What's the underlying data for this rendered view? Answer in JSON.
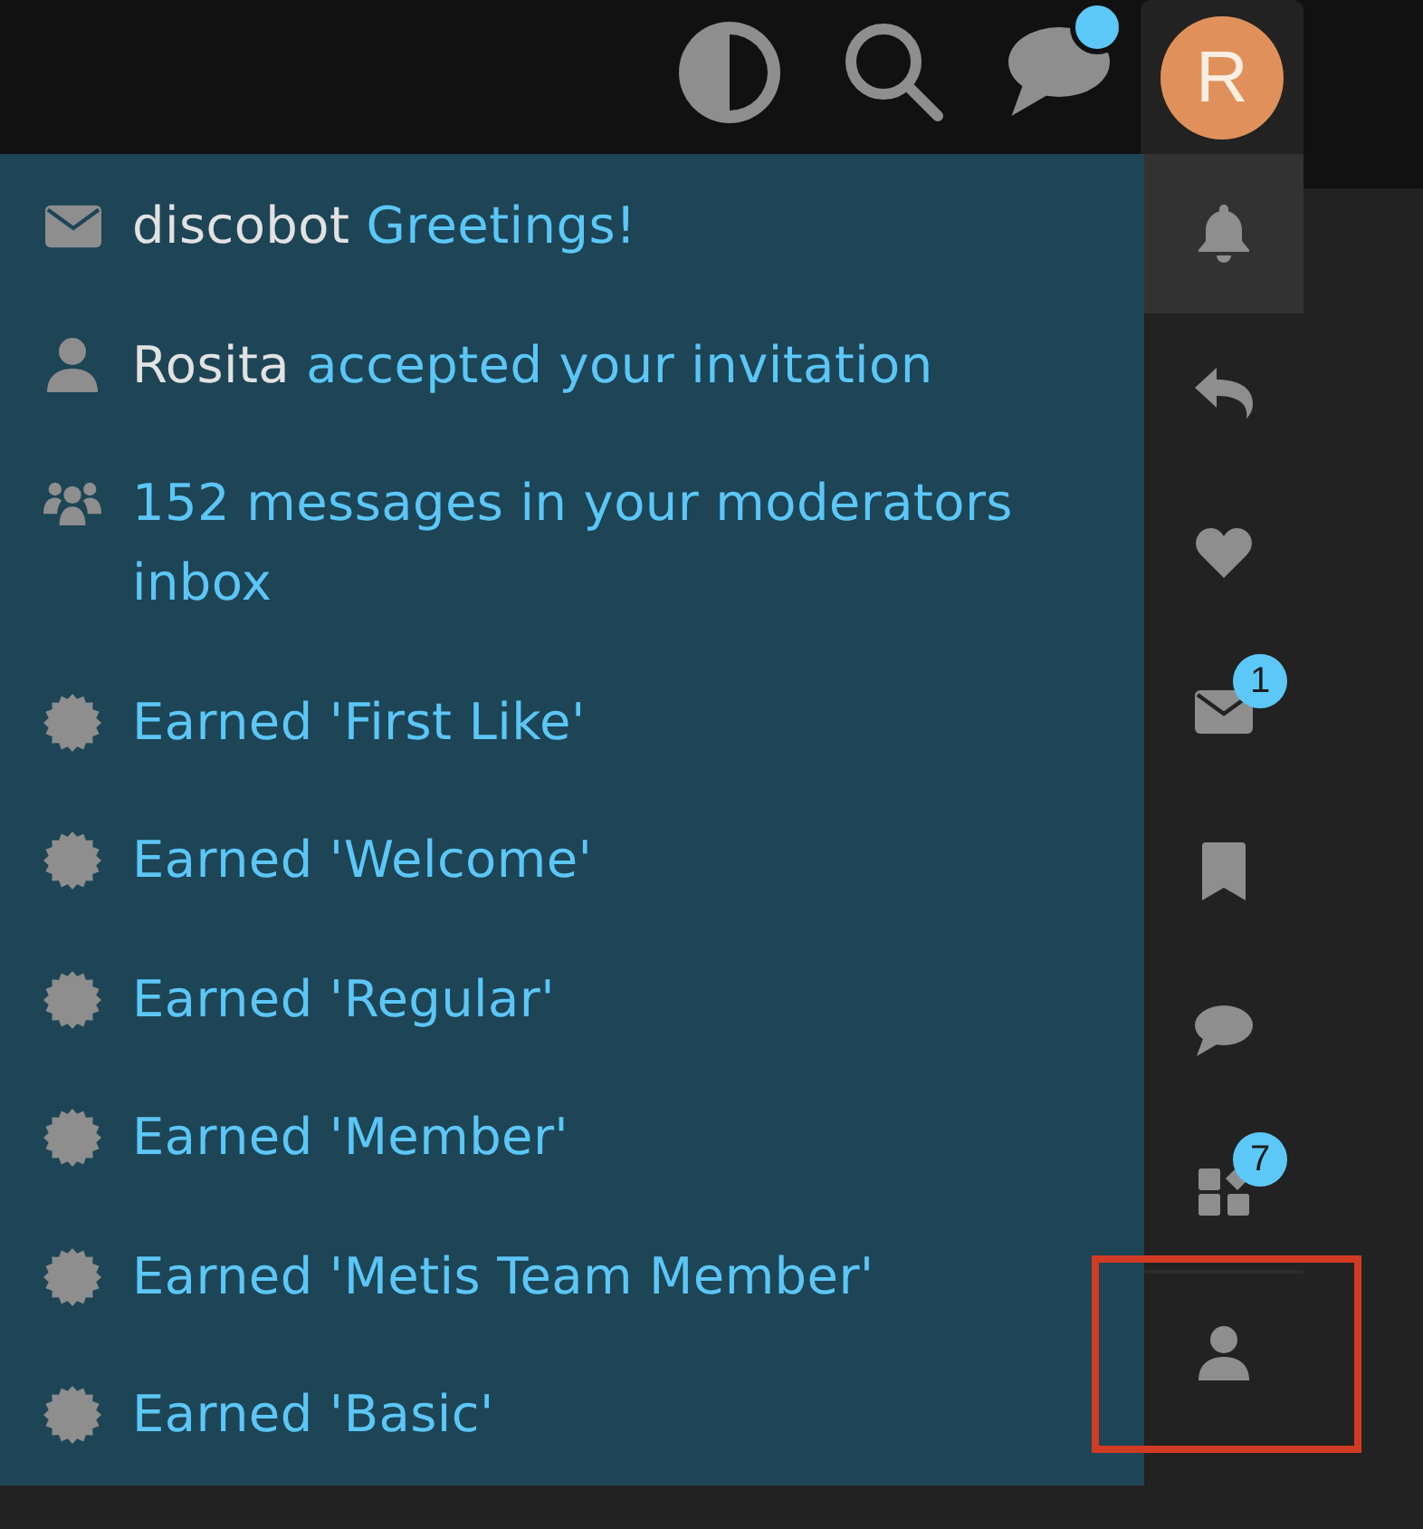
{
  "header": {
    "chat_unread": true,
    "avatar_letter": "R"
  },
  "notifications": [
    {
      "kind": "message",
      "user": "discobot",
      "text": "Greetings!"
    },
    {
      "kind": "invitation",
      "user": "Rosita",
      "text": "accepted your invitation"
    },
    {
      "kind": "group",
      "text": "152 messages in your moderators inbox"
    },
    {
      "kind": "badge",
      "text": "Earned 'First Like'"
    },
    {
      "kind": "badge",
      "text": "Earned 'Welcome'"
    },
    {
      "kind": "badge",
      "text": "Earned 'Regular'"
    },
    {
      "kind": "badge",
      "text": "Earned 'Member'"
    },
    {
      "kind": "badge",
      "text": "Earned 'Metis Team Member'"
    },
    {
      "kind": "badge",
      "text": "Earned 'Basic'"
    }
  ],
  "sidebar": {
    "tabs": [
      {
        "kind": "notifications",
        "selected": true
      },
      {
        "kind": "replies",
        "selected": false
      },
      {
        "kind": "likes",
        "selected": false
      },
      {
        "kind": "messages",
        "selected": false,
        "badge": "1"
      },
      {
        "kind": "bookmarks",
        "selected": false
      },
      {
        "kind": "chat",
        "selected": false
      },
      {
        "kind": "review",
        "selected": false,
        "badge": "7"
      }
    ],
    "bottom_tabs": [
      {
        "kind": "profile",
        "selected": false,
        "highlighted": true
      }
    ]
  }
}
